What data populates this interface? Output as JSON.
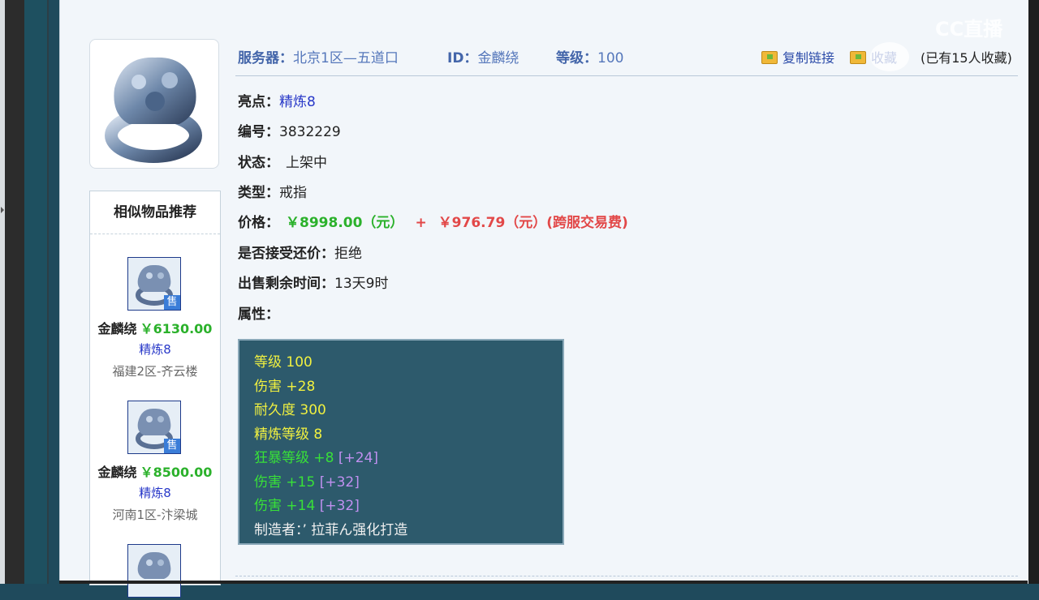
{
  "header": {
    "server_key": "服务器：",
    "server_value": "北京1区—五道口",
    "id_key": "ID：",
    "id_value": "金麟绕",
    "level_key": "等级：",
    "level_value": "100",
    "copy_link": "复制链接",
    "collect": "收藏",
    "collect_count": "(已有15人收藏)"
  },
  "info": {
    "highlight_key": "亮点：",
    "highlight_value": "精炼8",
    "number_key": "编号：",
    "number_value": "3832229",
    "status_key": "状态：",
    "status_value": "上架中",
    "type_key": "类型：",
    "type_value": "戒指",
    "price_key": "价格：",
    "price_value": "￥8998.00（元）",
    "price_plus": "+",
    "fee_value": "￥976.79（元）(跨服交易费)",
    "counter_key": "是否接受还价：",
    "counter_value": "拒绝",
    "remain_key": "出售剩余时间：",
    "remain_value": "13天9时",
    "attr_key": "属性："
  },
  "attributes": [
    {
      "text": "等级 100",
      "color": "yellow"
    },
    {
      "text": "伤害 +28",
      "color": "yellow"
    },
    {
      "text": "耐久度 300",
      "color": "yellow"
    },
    {
      "text": "精炼等级 8",
      "color": "yellow"
    },
    {
      "text": "狂暴等级 +8",
      "extra": "[+24]",
      "color": "green"
    },
    {
      "text": "伤害 +15",
      "extra": "[+32]",
      "color": "green"
    },
    {
      "text": "伤害 +14",
      "extra": "[+32]",
      "color": "green"
    },
    {
      "text": "制造者：’ 拉菲ん强化打造",
      "color": "white"
    }
  ],
  "recommend": {
    "title": "相似物品推荐",
    "sell_badge": "售",
    "items": [
      {
        "name": "金麟绕",
        "price": "￥6130.00",
        "refine": "精炼8",
        "server": "福建2区-齐云楼"
      },
      {
        "name": "金麟绕",
        "price": "￥8500.00",
        "refine": "精炼8",
        "server": "河南1区-汴梁城"
      }
    ]
  },
  "watermark": "CC直播",
  "colors": {
    "price_green": "#2bb12b",
    "fee_red": "#e24848",
    "link_blue": "#2838c8",
    "attr_bg": "#2d5a6c"
  }
}
